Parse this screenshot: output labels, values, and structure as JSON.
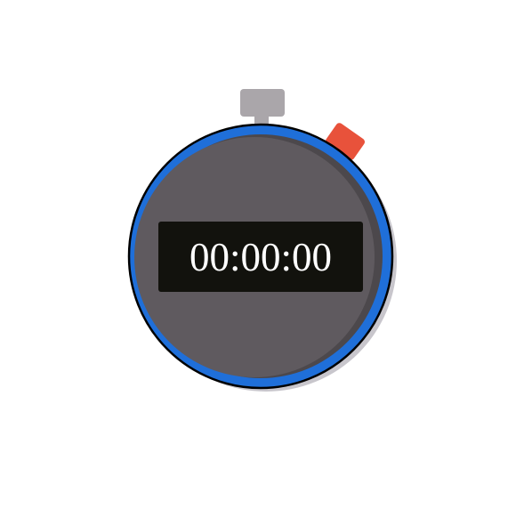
{
  "stopwatch": {
    "time_display": "00:00:00",
    "colors": {
      "bezel": "#1f6fd9",
      "bezel_outline": "#000000",
      "face": "#5f5a5f",
      "face_shade": "#4c484c",
      "drop_shadow": "#c8c6cc",
      "display_bg": "#12120d",
      "display_text": "#ffffff",
      "top_button": "#aaa6aa",
      "reset_button": "#e8523b"
    },
    "icons": {
      "start_stop": "top-crown-button",
      "reset": "side-reset-button"
    }
  }
}
